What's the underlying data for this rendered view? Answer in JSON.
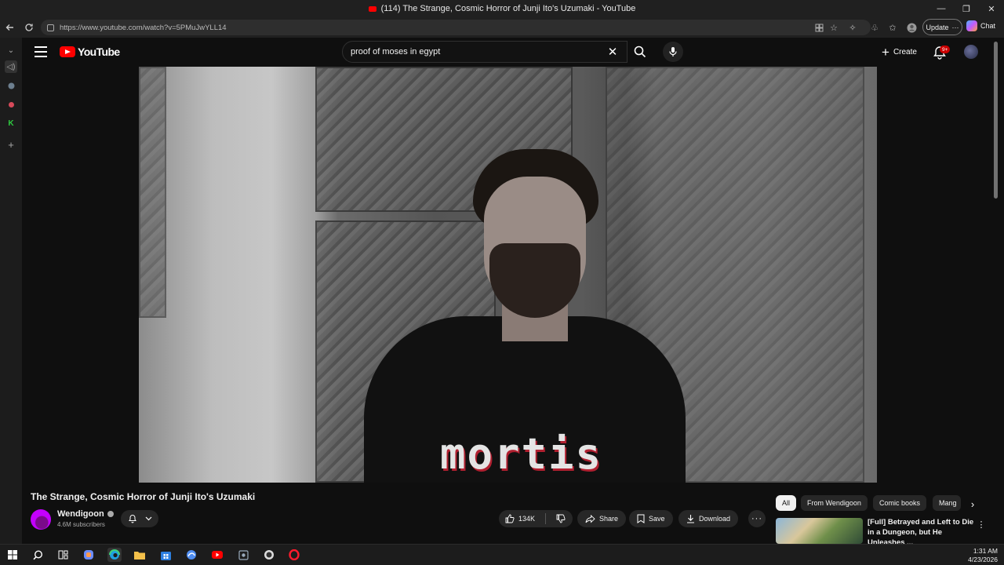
{
  "browser": {
    "window_title": "(114) The Strange, Cosmic Horror of Junji Ito's Uzumaki - YouTube",
    "url": "https://www.youtube.com/watch?v=5PMuJwYLL14",
    "update_label": "Update",
    "update_more": "···",
    "chat_label": "Chat",
    "min_icon": "—",
    "restore_icon": "❐",
    "close_icon": "✕"
  },
  "youtube": {
    "logo_text": "YouTube",
    "search_query": "proof of moses in egypt",
    "clear_icon": "✕",
    "create_label": "Create",
    "create_plus": "+",
    "notification_badge": "9+",
    "video_title": "The Strange, Cosmic Horror of Junji Ito's Uzumaki",
    "shirt_text": "mortis",
    "channel": {
      "name": "Wendigoon",
      "subscribers": "4.6M subscribers"
    },
    "actions": {
      "likes": "134K",
      "share": "Share",
      "save": "Save",
      "download": "Download",
      "more": "···"
    },
    "chips": [
      {
        "label": "All"
      },
      {
        "label": "From Wendigoon"
      },
      {
        "label": "Comic books"
      },
      {
        "label": "Mang"
      }
    ],
    "chip_next": "›",
    "recommendation": {
      "title": "[Full] Betrayed and Left to Die in a Dungeon, but He Unleashes ...",
      "more": "⋮"
    }
  },
  "taskbar": {
    "time": "1:31 AM",
    "date": "4/23/2026"
  },
  "colors": {
    "youtube_red": "#ff0000",
    "background": "#0f0f0f",
    "chip_active": "#f1f1f1",
    "pill_bg": "#272727",
    "channel_avatar": "#c400ff"
  }
}
